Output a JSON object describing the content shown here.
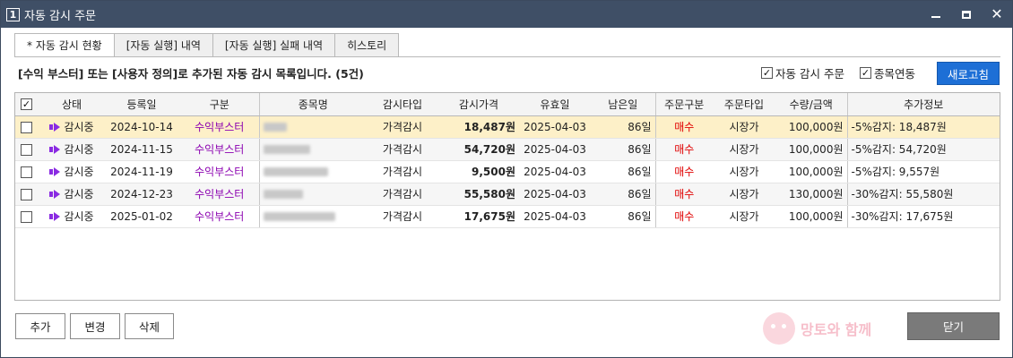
{
  "window": {
    "number": "1",
    "title": "자동 감시 주문",
    "close_glyph": "✕"
  },
  "tabs": [
    {
      "label": "* 자동 감시 현황",
      "active": true
    },
    {
      "label": "[자동 실행] 내역",
      "active": false
    },
    {
      "label": "[자동 실행] 실패 내역",
      "active": false
    },
    {
      "label": "히스토리",
      "active": false
    }
  ],
  "summary": "[수익 부스터] 또는 [사용자 정의]로 추가된 자동 감시 목록입니다. (5건)",
  "options": {
    "auto_order": {
      "label": "자동 감시 주문",
      "checked": true
    },
    "stock_link": {
      "label": "종목연동",
      "checked": true
    }
  },
  "refresh_label": "새로고침",
  "table": {
    "headers": [
      "상태",
      "등록일",
      "구분",
      "종목명",
      "감시타입",
      "감시가격",
      "유효일",
      "남은일",
      "주문구분",
      "주문타입",
      "수량/금액",
      "추가정보"
    ],
    "rows": [
      {
        "status": "감시중",
        "date": "2024-10-14",
        "category": "수익부스터",
        "type": "가격감시",
        "price": "18,487원",
        "valid": "2025-04-03",
        "remain": "86일",
        "side": "매수",
        "order_type": "시장가",
        "qty": "100,000원",
        "info": "-5%감지: 18,487원"
      },
      {
        "status": "감시중",
        "date": "2024-11-15",
        "category": "수익부스터",
        "type": "가격감시",
        "price": "54,720원",
        "valid": "2025-04-03",
        "remain": "86일",
        "side": "매수",
        "order_type": "시장가",
        "qty": "100,000원",
        "info": "-5%감지: 54,720원"
      },
      {
        "status": "감시중",
        "date": "2024-11-19",
        "category": "수익부스터",
        "type": "가격감시",
        "price": "9,500원",
        "valid": "2025-04-03",
        "remain": "86일",
        "side": "매수",
        "order_type": "시장가",
        "qty": "100,000원",
        "info": "-5%감지: 9,557원"
      },
      {
        "status": "감시중",
        "date": "2024-12-23",
        "category": "수익부스터",
        "type": "가격감시",
        "price": "55,580원",
        "valid": "2025-04-03",
        "remain": "86일",
        "side": "매수",
        "order_type": "시장가",
        "qty": "130,000원",
        "info": "-30%감지: 55,580원"
      },
      {
        "status": "감시중",
        "date": "2025-01-02",
        "category": "수익부스터",
        "type": "가격감시",
        "price": "17,675원",
        "valid": "2025-04-03",
        "remain": "86일",
        "side": "매수",
        "order_type": "시장가",
        "qty": "100,000원",
        "info": "-30%감지: 17,675원"
      }
    ]
  },
  "buttons": {
    "add": "추가",
    "edit": "변경",
    "delete": "삭제",
    "close": "닫기"
  },
  "watermark": "망토와 함께",
  "colors": {
    "titlebar": "#3f4f66",
    "accent": "#1d6fd6",
    "category": "#8b00b0",
    "buy": "#e00000",
    "selected_row": "#fdf0c8"
  }
}
